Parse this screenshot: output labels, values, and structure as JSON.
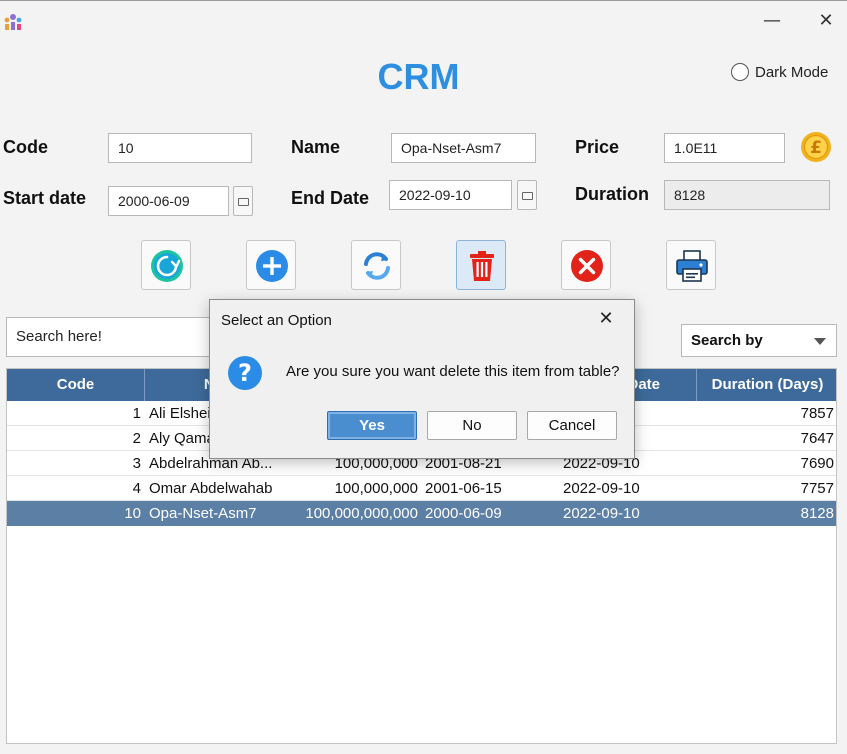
{
  "window": {
    "minimize_glyph": "—",
    "close_glyph": "✕"
  },
  "app": {
    "title": "CRM",
    "dark_mode_label": "Dark Mode",
    "accent_color": "#2e8fe0"
  },
  "form": {
    "code_label": "Code",
    "code_value": "10",
    "name_label": "Name",
    "name_value": "Opa-Nset-Asm7",
    "price_label": "Price",
    "price_value": "1.0E11",
    "start_label": "Start date",
    "start_value": "2000-06-09",
    "end_label": "End Date",
    "end_value": "2022-09-10",
    "duration_label": "Duration",
    "duration_value": "8128"
  },
  "toolbar": {
    "icons": [
      "refresh-circle-icon",
      "add-icon",
      "sync-icon",
      "trash-icon",
      "cancel-icon",
      "printer-icon"
    ]
  },
  "search": {
    "placeholder": "Search here!",
    "search_by_label": "Search by"
  },
  "table": {
    "header_color": "#3d6a9a",
    "selected_color": "#5c7fa5",
    "columns": [
      "Code",
      "Na",
      "",
      "",
      "Date",
      "Duration (Days)"
    ],
    "rows": [
      {
        "code": "1",
        "name": "Ali Elshei",
        "price": "",
        "start": "",
        "end": "0",
        "duration": "7857"
      },
      {
        "code": "2",
        "name": "Aly Qama",
        "price": "",
        "start": "",
        "end": "0",
        "duration": "7647"
      },
      {
        "code": "3",
        "name": "Abdelrahman Ab...",
        "price": "100,000,000",
        "start": "2001-08-21",
        "end": "2022-09-10",
        "duration": "7690"
      },
      {
        "code": "4",
        "name": "Omar Abdelwahab",
        "price": "100,000,000",
        "start": "2001-06-15",
        "end": "2022-09-10",
        "duration": "7757"
      },
      {
        "code": "10",
        "name": "Opa-Nset-Asm7",
        "price": "100,000,000,000",
        "start": "2000-06-09",
        "end": "2022-09-10",
        "duration": "8128"
      }
    ],
    "selected_row": 4
  },
  "dialog": {
    "title": "Select an Option",
    "close_glyph": "✕",
    "message": "Are you sure you want delete this item from table?",
    "yes_label": "Yes",
    "no_label": "No",
    "cancel_label": "Cancel",
    "default_color": "#4a8ed0"
  }
}
